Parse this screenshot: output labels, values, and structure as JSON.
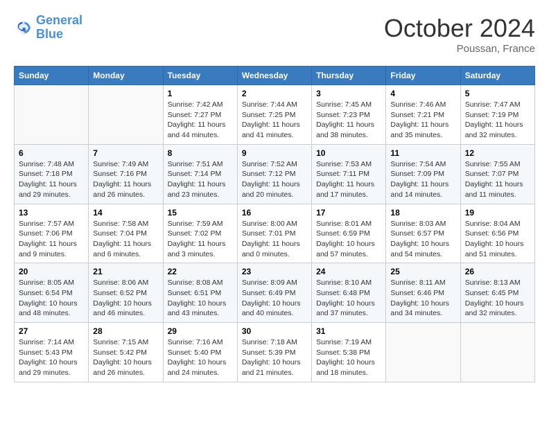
{
  "header": {
    "logo_line1": "General",
    "logo_line2": "Blue",
    "month": "October 2024",
    "location": "Poussan, France"
  },
  "columns": [
    "Sunday",
    "Monday",
    "Tuesday",
    "Wednesday",
    "Thursday",
    "Friday",
    "Saturday"
  ],
  "weeks": [
    [
      {
        "day": "",
        "info": ""
      },
      {
        "day": "",
        "info": ""
      },
      {
        "day": "1",
        "info": "Sunrise: 7:42 AM\nSunset: 7:27 PM\nDaylight: 11 hours and 44 minutes."
      },
      {
        "day": "2",
        "info": "Sunrise: 7:44 AM\nSunset: 7:25 PM\nDaylight: 11 hours and 41 minutes."
      },
      {
        "day": "3",
        "info": "Sunrise: 7:45 AM\nSunset: 7:23 PM\nDaylight: 11 hours and 38 minutes."
      },
      {
        "day": "4",
        "info": "Sunrise: 7:46 AM\nSunset: 7:21 PM\nDaylight: 11 hours and 35 minutes."
      },
      {
        "day": "5",
        "info": "Sunrise: 7:47 AM\nSunset: 7:19 PM\nDaylight: 11 hours and 32 minutes."
      }
    ],
    [
      {
        "day": "6",
        "info": "Sunrise: 7:48 AM\nSunset: 7:18 PM\nDaylight: 11 hours and 29 minutes."
      },
      {
        "day": "7",
        "info": "Sunrise: 7:49 AM\nSunset: 7:16 PM\nDaylight: 11 hours and 26 minutes."
      },
      {
        "day": "8",
        "info": "Sunrise: 7:51 AM\nSunset: 7:14 PM\nDaylight: 11 hours and 23 minutes."
      },
      {
        "day": "9",
        "info": "Sunrise: 7:52 AM\nSunset: 7:12 PM\nDaylight: 11 hours and 20 minutes."
      },
      {
        "day": "10",
        "info": "Sunrise: 7:53 AM\nSunset: 7:11 PM\nDaylight: 11 hours and 17 minutes."
      },
      {
        "day": "11",
        "info": "Sunrise: 7:54 AM\nSunset: 7:09 PM\nDaylight: 11 hours and 14 minutes."
      },
      {
        "day": "12",
        "info": "Sunrise: 7:55 AM\nSunset: 7:07 PM\nDaylight: 11 hours and 11 minutes."
      }
    ],
    [
      {
        "day": "13",
        "info": "Sunrise: 7:57 AM\nSunset: 7:06 PM\nDaylight: 11 hours and 9 minutes."
      },
      {
        "day": "14",
        "info": "Sunrise: 7:58 AM\nSunset: 7:04 PM\nDaylight: 11 hours and 6 minutes."
      },
      {
        "day": "15",
        "info": "Sunrise: 7:59 AM\nSunset: 7:02 PM\nDaylight: 11 hours and 3 minutes."
      },
      {
        "day": "16",
        "info": "Sunrise: 8:00 AM\nSunset: 7:01 PM\nDaylight: 11 hours and 0 minutes."
      },
      {
        "day": "17",
        "info": "Sunrise: 8:01 AM\nSunset: 6:59 PM\nDaylight: 10 hours and 57 minutes."
      },
      {
        "day": "18",
        "info": "Sunrise: 8:03 AM\nSunset: 6:57 PM\nDaylight: 10 hours and 54 minutes."
      },
      {
        "day": "19",
        "info": "Sunrise: 8:04 AM\nSunset: 6:56 PM\nDaylight: 10 hours and 51 minutes."
      }
    ],
    [
      {
        "day": "20",
        "info": "Sunrise: 8:05 AM\nSunset: 6:54 PM\nDaylight: 10 hours and 48 minutes."
      },
      {
        "day": "21",
        "info": "Sunrise: 8:06 AM\nSunset: 6:52 PM\nDaylight: 10 hours and 46 minutes."
      },
      {
        "day": "22",
        "info": "Sunrise: 8:08 AM\nSunset: 6:51 PM\nDaylight: 10 hours and 43 minutes."
      },
      {
        "day": "23",
        "info": "Sunrise: 8:09 AM\nSunset: 6:49 PM\nDaylight: 10 hours and 40 minutes."
      },
      {
        "day": "24",
        "info": "Sunrise: 8:10 AM\nSunset: 6:48 PM\nDaylight: 10 hours and 37 minutes."
      },
      {
        "day": "25",
        "info": "Sunrise: 8:11 AM\nSunset: 6:46 PM\nDaylight: 10 hours and 34 minutes."
      },
      {
        "day": "26",
        "info": "Sunrise: 8:13 AM\nSunset: 6:45 PM\nDaylight: 10 hours and 32 minutes."
      }
    ],
    [
      {
        "day": "27",
        "info": "Sunrise: 7:14 AM\nSunset: 5:43 PM\nDaylight: 10 hours and 29 minutes."
      },
      {
        "day": "28",
        "info": "Sunrise: 7:15 AM\nSunset: 5:42 PM\nDaylight: 10 hours and 26 minutes."
      },
      {
        "day": "29",
        "info": "Sunrise: 7:16 AM\nSunset: 5:40 PM\nDaylight: 10 hours and 24 minutes."
      },
      {
        "day": "30",
        "info": "Sunrise: 7:18 AM\nSunset: 5:39 PM\nDaylight: 10 hours and 21 minutes."
      },
      {
        "day": "31",
        "info": "Sunrise: 7:19 AM\nSunset: 5:38 PM\nDaylight: 10 hours and 18 minutes."
      },
      {
        "day": "",
        "info": ""
      },
      {
        "day": "",
        "info": ""
      }
    ]
  ]
}
